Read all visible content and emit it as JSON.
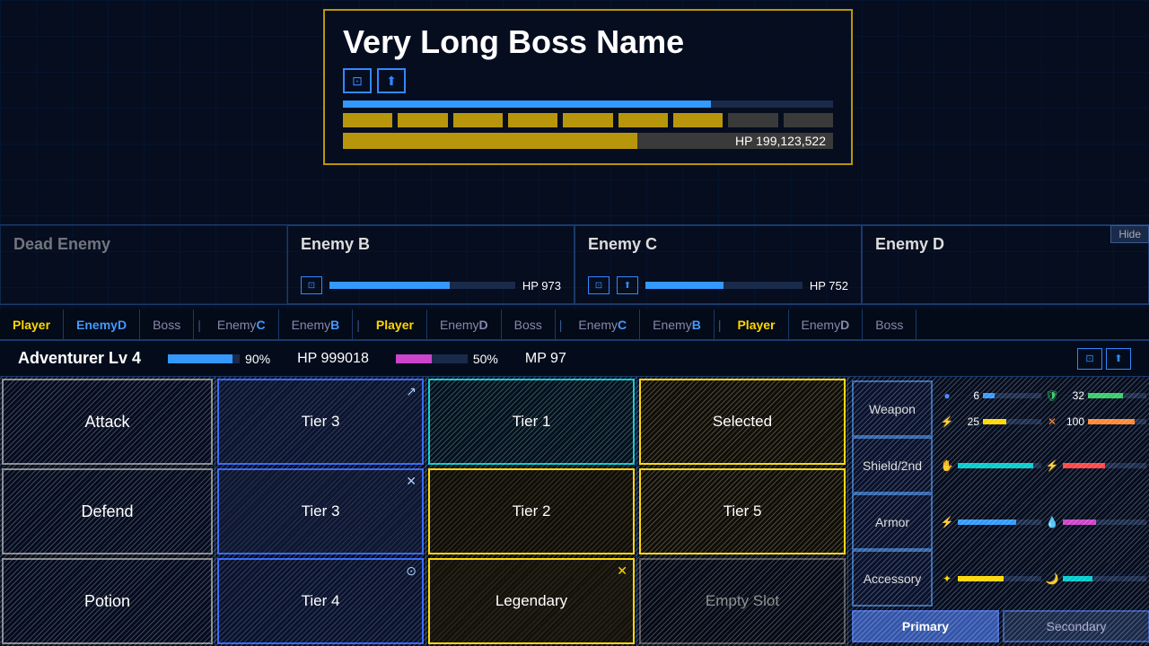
{
  "boss": {
    "name": "Very Long Boss Name",
    "hp_text": "HP 199,123,522",
    "hp_percent": 60,
    "mp_percent": 75,
    "atb_segments": [
      1,
      1,
      1,
      1,
      1,
      1,
      1,
      0,
      0
    ]
  },
  "enemies": [
    {
      "name": "Dead Enemy",
      "dead": true,
      "hp": "",
      "hp_percent": 0,
      "icons": 0
    },
    {
      "name": "Enemy B",
      "dead": false,
      "hp": "HP 973",
      "hp_percent": 65,
      "icons": 1
    },
    {
      "name": "Enemy C",
      "dead": false,
      "hp": "HP 752",
      "hp_percent": 50,
      "icons": 2
    },
    {
      "name": "Enemy D",
      "dead": false,
      "hp": "",
      "hp_percent": 0,
      "icons": 0
    }
  ],
  "hide_label": "Hide",
  "tabs": [
    {
      "label": "Player",
      "style": "active-yellow"
    },
    {
      "label": "Enemy D",
      "style": "active-blue"
    },
    {
      "label": "Boss",
      "style": ""
    },
    {
      "label": "|",
      "style": "separator"
    },
    {
      "label": "Enemy C",
      "style": ""
    },
    {
      "label": "Enemy B",
      "style": ""
    },
    {
      "label": "|",
      "style": "separator"
    },
    {
      "label": "Player",
      "style": "active-yellow"
    },
    {
      "label": "Enemy D",
      "style": ""
    },
    {
      "label": "Boss",
      "style": ""
    },
    {
      "label": "|",
      "style": "separator"
    },
    {
      "label": "Enemy C",
      "style": ""
    },
    {
      "label": "Enemy B",
      "style": ""
    },
    {
      "label": "|",
      "style": "separator"
    },
    {
      "label": "Player",
      "style": "active-yellow"
    },
    {
      "label": "Enemy D",
      "style": ""
    },
    {
      "label": "Boss",
      "style": ""
    }
  ],
  "player": {
    "name": "Adventurer Lv 4",
    "hp_percent_label": "90%",
    "hp_value": "HP 999018",
    "mp_percent_label": "50%",
    "mp_value": "MP 97"
  },
  "actions": [
    {
      "label": "Attack"
    },
    {
      "label": "Defend"
    },
    {
      "label": "Potion"
    }
  ],
  "skills_blue": [
    {
      "label": "Tier 3",
      "icon": "↗"
    },
    {
      "label": "Tier 3",
      "icon": "✕"
    },
    {
      "label": "Tier 4",
      "icon": "⊙"
    }
  ],
  "skills_cyan": [
    {
      "label": "Tier 1",
      "style": "cyan"
    },
    {
      "label": "Tier 2",
      "style": "yellow"
    },
    {
      "label": "Legendary",
      "style": "yellow",
      "icon": "✕"
    }
  ],
  "skills_right": [
    {
      "label": "Selected",
      "style": "selected"
    },
    {
      "label": "Tier 5",
      "style": "gold"
    },
    {
      "label": "Empty Slot",
      "style": "empty"
    }
  ],
  "equipment": {
    "slots": [
      {
        "label": "Weapon"
      },
      {
        "label": "Shield/2nd"
      },
      {
        "label": "Armor"
      },
      {
        "label": "Accessory"
      }
    ],
    "stats_rows": [
      [
        {
          "icon": "🔵",
          "value": "6",
          "color": "blue",
          "pct": 20
        },
        {
          "icon": "🛡",
          "value": "32",
          "color": "green",
          "pct": 60
        }
      ],
      [
        {
          "icon": "⚡",
          "value": "25",
          "color": "yellow",
          "pct": 40
        },
        {
          "icon": "✕",
          "value": "100",
          "color": "orange",
          "pct": 80
        }
      ],
      [
        {
          "icon": "✋",
          "value": "",
          "color": "cyan",
          "pct": 90,
          "bar_only": true
        },
        {
          "icon": "⚡",
          "value": "",
          "color": "red",
          "pct": 50,
          "bar_only": true
        }
      ],
      [
        {
          "icon": "⚡",
          "value": "",
          "color": "blue",
          "pct": 70,
          "bar_only": true
        },
        {
          "icon": "💧",
          "value": "",
          "color": "purple",
          "pct": 40,
          "bar_only": true
        }
      ],
      [
        {
          "icon": "✦",
          "value": "",
          "color": "yellow",
          "pct": 55,
          "bar_only": true
        },
        {
          "icon": "🌙",
          "value": "",
          "color": "cyan",
          "pct": 35,
          "bar_only": true
        }
      ]
    ],
    "buttons": {
      "primary": "Primary",
      "secondary": "Secondary"
    }
  }
}
